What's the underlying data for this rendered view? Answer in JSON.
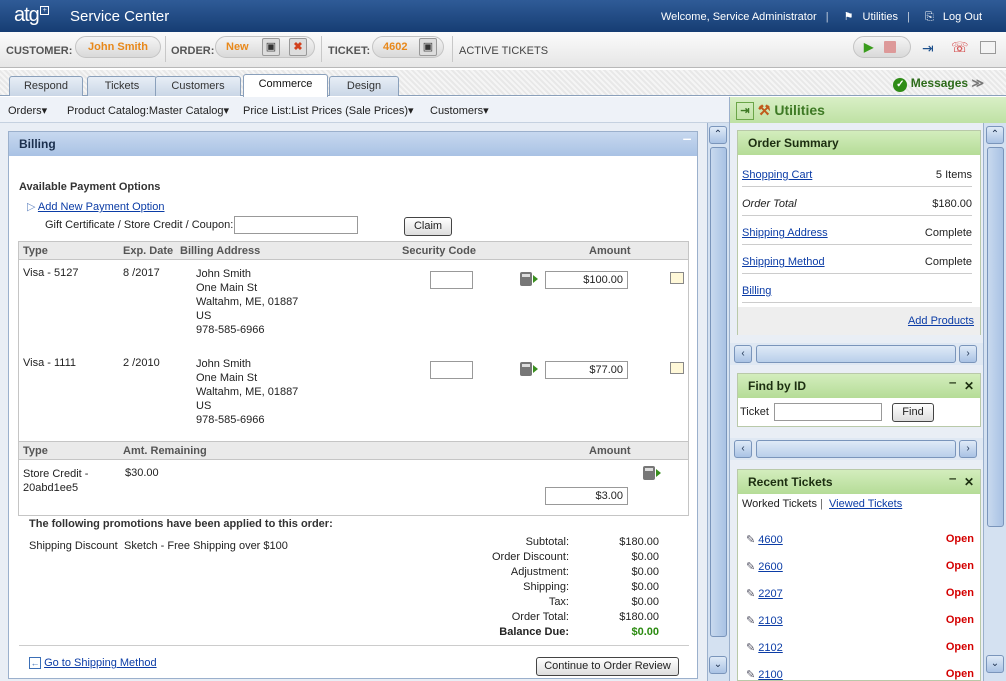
{
  "app": {
    "logo": "atg",
    "title": "Service Center"
  },
  "topbar": {
    "welcome": "Welcome, Service Administrator",
    "utilities": "Utilities",
    "logout": "Log Out"
  },
  "context": {
    "customer_label": "CUSTOMER:",
    "customer_value": "John Smith",
    "order_label": "ORDER:",
    "order_value": "New",
    "ticket_label": "TICKET:",
    "ticket_value": "4602",
    "active_tickets": "ACTIVE TICKETS"
  },
  "tabs": [
    {
      "label": "Respond"
    },
    {
      "label": "Tickets"
    },
    {
      "label": "Customers"
    },
    {
      "label": "Commerce"
    },
    {
      "label": "Design"
    }
  ],
  "messages": "Messages",
  "nav": {
    "orders": "Orders▾",
    "catalog": "Product Catalog:Master Catalog▾",
    "pricelist": "Price List:List Prices (Sale Prices)▾",
    "customers": "Customers▾"
  },
  "billing": {
    "title": "Billing",
    "available_options": "Available Payment Options",
    "add_new": "Add New Payment Option",
    "coupon_label": "Gift Certificate / Store Credit / Coupon:",
    "claim": "Claim",
    "cards_headers": {
      "type": "Type",
      "exp": "Exp. Date",
      "address": "Billing Address",
      "security": "Security Code",
      "amount": "Amount"
    },
    "cards": [
      {
        "type": "Visa  -  5127",
        "exp": "8 /2017",
        "name": "John Smith",
        "street": "One Main St",
        "city": "Waltahm, ME, 01887",
        "country": "US",
        "phone": "978-585-6966",
        "amount": "$100.00"
      },
      {
        "type": "Visa  -  1111",
        "exp": "2 /2010",
        "name": "John Smith",
        "street": "One Main St",
        "city": "Waltahm, ME, 01887",
        "country": "US",
        "phone": "978-585-6966",
        "amount": "$77.00"
      }
    ],
    "credit_headers": {
      "type": "Type",
      "remaining": "Amt. Remaining",
      "amount": "Amount"
    },
    "credit": {
      "type_line1": "Store Credit -",
      "type_line2": "20abd1ee5",
      "remaining": "$30.00",
      "amount": "$3.00"
    },
    "promo_title": "The following promotions have been applied to this order:",
    "promo_name": "Shipping Discount",
    "promo_desc": "Sketch - Free Shipping over $100",
    "totals": [
      {
        "label": "Subtotal:",
        "value": "$180.00"
      },
      {
        "label": "Order Discount:",
        "value": "$0.00"
      },
      {
        "label": "Adjustment:",
        "value": "$0.00"
      },
      {
        "label": "Shipping:",
        "value": "$0.00"
      },
      {
        "label": "Tax:",
        "value": "$0.00"
      },
      {
        "label": "Order Total:",
        "value": "$180.00"
      }
    ],
    "balance_label": "Balance Due:",
    "balance_value": "$0.00",
    "goto_shipping": "Go to Shipping Method",
    "continue": "Continue to Order Review"
  },
  "utilities": {
    "title": "Utilities",
    "order_summary": {
      "title": "Order Summary",
      "rows": [
        {
          "label": "Shopping Cart",
          "value": "5 Items"
        },
        {
          "label": "Order Total",
          "value": "$180.00"
        },
        {
          "label": "Shipping Address",
          "value": "Complete"
        },
        {
          "label": "Shipping Method",
          "value": "Complete"
        },
        {
          "label": "Billing",
          "value": ""
        }
      ],
      "add_products": "Add Products"
    },
    "find_by_id": {
      "title": "Find by ID",
      "label": "Ticket",
      "button": "Find"
    },
    "recent_tickets": {
      "title": "Recent Tickets",
      "worked": "Worked Tickets",
      "viewed": "Viewed Tickets",
      "tickets": [
        {
          "id": "4600",
          "status": "Open"
        },
        {
          "id": "2600",
          "status": "Open"
        },
        {
          "id": "2207",
          "status": "Open"
        },
        {
          "id": "2103",
          "status": "Open"
        },
        {
          "id": "2102",
          "status": "Open"
        },
        {
          "id": "2100",
          "status": "Open"
        }
      ]
    }
  }
}
